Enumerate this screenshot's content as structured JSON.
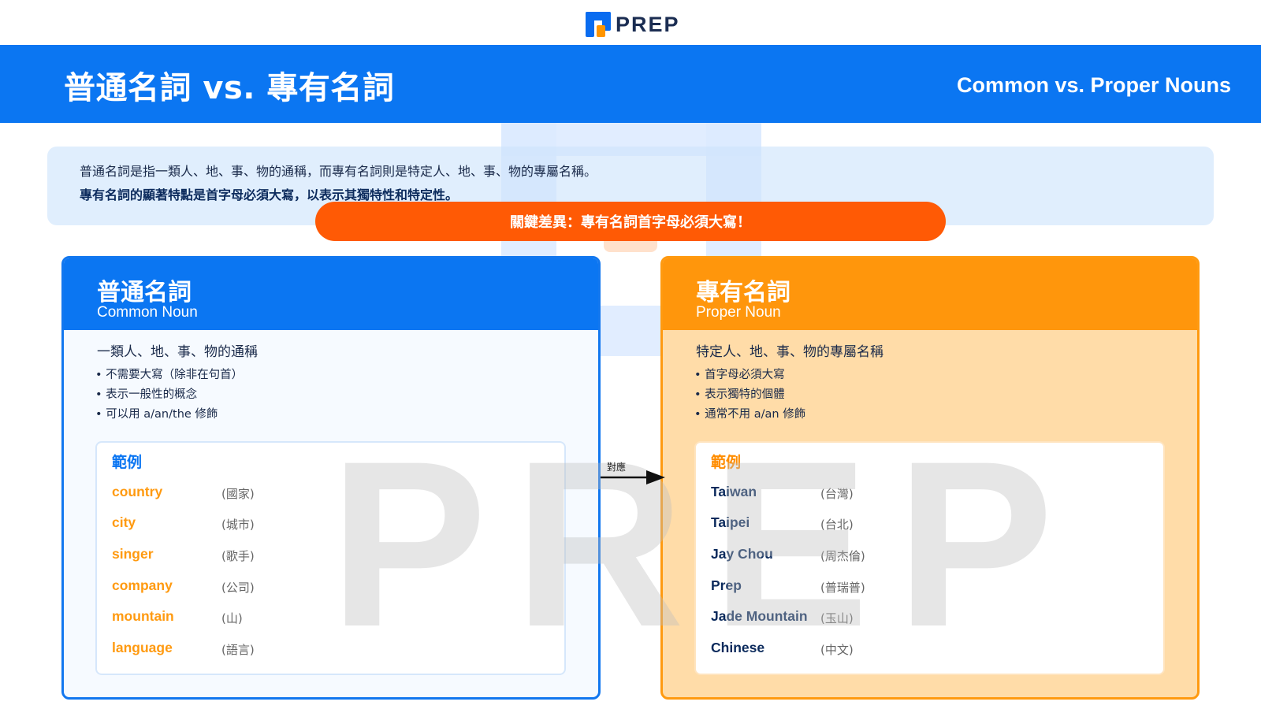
{
  "logo": {
    "text": "PREP"
  },
  "header": {
    "title": "普通名詞 vs. 專有名詞",
    "subtitle": "Common vs. Proper Nouns"
  },
  "intro": {
    "line1": "普通名詞是指一類人、地、事、物的通稱，而專有名詞則是特定人、地、事、物的專屬名稱。",
    "line2": "專有名詞的顯著特點是首字母必須大寫，以表示其獨特性和特定性。"
  },
  "key_point": "關鍵差異：專有名詞首字母必須大寫！",
  "watermark": "PREP",
  "connector": {
    "label": "對應"
  },
  "common": {
    "title": "普通名詞",
    "title_en": "Common Noun",
    "description": "一類人、地、事、物的通稱",
    "bullets": [
      "不需要大寫（除非在句首）",
      "表示一般性的概念",
      "可以用 a/an/the 修飾"
    ],
    "examples_title": "範例",
    "examples": [
      {
        "word": "country",
        "translation": "(國家)"
      },
      {
        "word": "city",
        "translation": "(城市)"
      },
      {
        "word": "singer",
        "translation": "(歌手)"
      },
      {
        "word": "company",
        "translation": "(公司)"
      },
      {
        "word": "mountain",
        "translation": "(山)"
      },
      {
        "word": "language",
        "translation": "(語言)"
      }
    ]
  },
  "proper": {
    "title": "專有名詞",
    "title_en": "Proper Noun",
    "description": "特定人、地、事、物的專屬名稱",
    "bullets": [
      "首字母必須大寫",
      "表示獨特的個體",
      "通常不用 a/an 修飾"
    ],
    "examples_title": "範例",
    "examples": [
      {
        "word": "Taiwan",
        "translation": "(台灣)"
      },
      {
        "word": "Taipei",
        "translation": "(台北)"
      },
      {
        "word": "Jay Chou",
        "translation": "(周杰倫)"
      },
      {
        "word": "Prep",
        "translation": "(普瑞普)"
      },
      {
        "word": "Jade Mountain",
        "translation": "(玉山)"
      },
      {
        "word": "Chinese",
        "translation": "(中文)"
      }
    ]
  },
  "colors": {
    "brand_blue": "#0b76f2",
    "brand_orange": "#ff960c",
    "key_orange": "#ff5a05"
  }
}
